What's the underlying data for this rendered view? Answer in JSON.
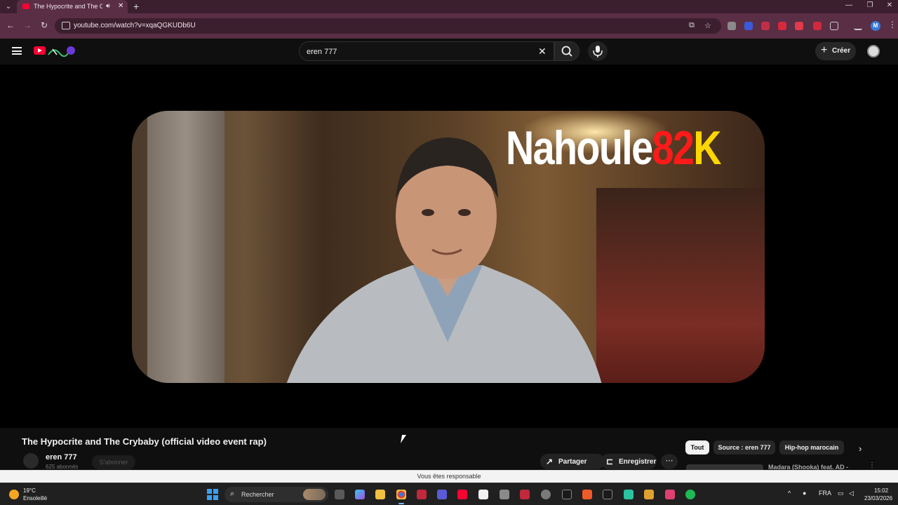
{
  "browser": {
    "tab_title": "The Hypocrite and The Crybaby",
    "url": "youtube.com/watch?v=xqaQGKUDb6U",
    "profile_initial": "M",
    "icons": [
      "tab-list-icon",
      "speaker-icon",
      "close-icon",
      "plus-icon",
      "back-icon",
      "forward-icon",
      "reload-icon",
      "site-info-icon",
      "install-icon",
      "star-icon",
      "extensions-icon",
      "menu-icon"
    ]
  },
  "youtube": {
    "search_query": "eren 777",
    "create_label": "Créer"
  },
  "video": {
    "thumbnail_brand": {
      "part1": "Nahoule",
      "part2": "82",
      "part3": "K"
    },
    "title": "The Hypocrite and The Crybaby (official video event rap)",
    "channel": "eren 777",
    "subscribers": "625 abonnés",
    "subscribe_label": "S'abonner",
    "share_label": "Partager",
    "save_label": "Enregistrer"
  },
  "chips": [
    {
      "label": "Tout",
      "active": true
    },
    {
      "label": "Source : eren 777",
      "active": false
    },
    {
      "label": "Hip-hop marocain",
      "active": false
    }
  ],
  "next_video": "Madara (Shooka) feat. AD -",
  "notice": "Vous êtes responsable",
  "taskbar": {
    "weather_temp": "19°C",
    "weather_condition": "Ensoleillé",
    "search_placeholder": "Rechercher",
    "language": "FRA",
    "time": "15:02",
    "date": "23/03/2026"
  },
  "colors": {
    "browser_frame": "#5a2e45",
    "youtube_red": "#ff0033",
    "brand_red": "#ff1a1a",
    "brand_yellow": "#ffd700"
  }
}
